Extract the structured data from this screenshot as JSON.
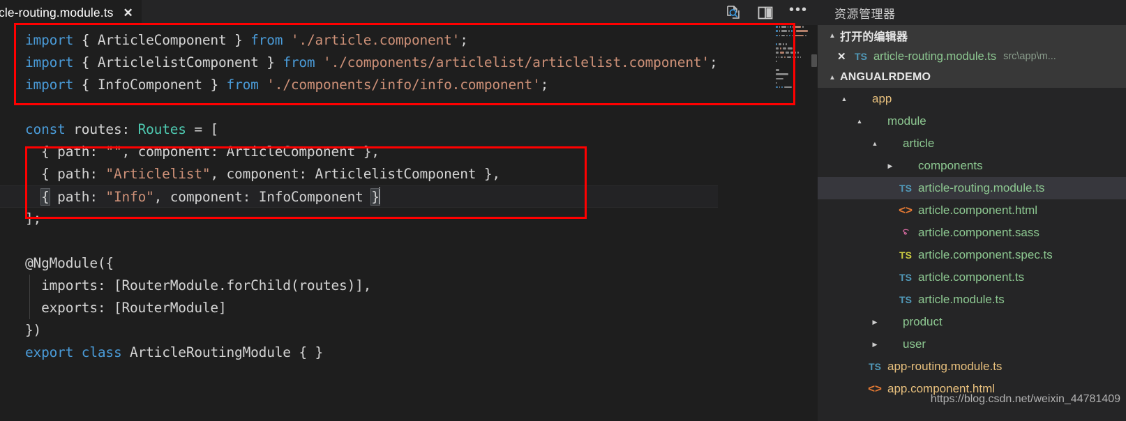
{
  "editor": {
    "tab": {
      "label": "icle-routing.module.ts",
      "close_glyph": "✕"
    },
    "actions": {
      "preview_icon": "open-preview-icon",
      "split_icon": "split-editor-icon",
      "more_glyph": "•••"
    },
    "code_lines": [
      {
        "id": 1,
        "tokens": [
          {
            "t": "import",
            "c": "kw"
          },
          {
            "t": " { ",
            "c": "brk"
          },
          {
            "t": "ArticleComponent",
            "c": "pln"
          },
          {
            "t": " } ",
            "c": "brk"
          },
          {
            "t": "from",
            "c": "kw"
          },
          {
            "t": " ",
            "c": "pln"
          },
          {
            "t": "'./article.component'",
            "c": "str"
          },
          {
            "t": ";",
            "c": "pln"
          }
        ]
      },
      {
        "id": 2,
        "tokens": [
          {
            "t": "import",
            "c": "kw"
          },
          {
            "t": " { ",
            "c": "brk"
          },
          {
            "t": "ArticlelistComponent",
            "c": "pln"
          },
          {
            "t": " } ",
            "c": "brk"
          },
          {
            "t": "from",
            "c": "kw"
          },
          {
            "t": " ",
            "c": "pln"
          },
          {
            "t": "'./components/articlelist/articlelist.component'",
            "c": "str"
          },
          {
            "t": ";",
            "c": "pln"
          }
        ]
      },
      {
        "id": 3,
        "tokens": [
          {
            "t": "import",
            "c": "kw"
          },
          {
            "t": " { ",
            "c": "brk"
          },
          {
            "t": "InfoComponent",
            "c": "pln"
          },
          {
            "t": " } ",
            "c": "brk"
          },
          {
            "t": "from",
            "c": "kw"
          },
          {
            "t": " ",
            "c": "pln"
          },
          {
            "t": "'./components/info/info.component'",
            "c": "str"
          },
          {
            "t": ";",
            "c": "pln"
          }
        ]
      },
      {
        "id": 4,
        "tokens": []
      },
      {
        "id": 5,
        "tokens": [
          {
            "t": "const",
            "c": "kw"
          },
          {
            "t": " routes: ",
            "c": "pln"
          },
          {
            "t": "Routes",
            "c": "typ"
          },
          {
            "t": " = [",
            "c": "pln"
          }
        ]
      },
      {
        "id": 6,
        "tokens": [
          {
            "t": "  { path: ",
            "c": "pln"
          },
          {
            "t": "\"\"",
            "c": "str"
          },
          {
            "t": ", component: ",
            "c": "pln"
          },
          {
            "t": "ArticleComponent",
            "c": "pln"
          },
          {
            "t": " },",
            "c": "pln"
          }
        ]
      },
      {
        "id": 7,
        "tokens": [
          {
            "t": "  { path: ",
            "c": "pln"
          },
          {
            "t": "\"Articlelist\"",
            "c": "str"
          },
          {
            "t": ", component: ",
            "c": "pln"
          },
          {
            "t": "ArticlelistComponent",
            "c": "pln"
          },
          {
            "t": " },",
            "c": "pln"
          }
        ]
      },
      {
        "id": 8,
        "active": true,
        "tokens": [
          {
            "t": "  ",
            "c": "pln"
          },
          {
            "t": "{",
            "c": "match"
          },
          {
            "t": " path: ",
            "c": "pln"
          },
          {
            "t": "\"Info\"",
            "c": "str"
          },
          {
            "t": ", component: ",
            "c": "pln"
          },
          {
            "t": "InfoComponent",
            "c": "pln"
          },
          {
            "t": " ",
            "c": "pln"
          },
          {
            "t": "}",
            "c": "match"
          },
          {
            "t": "__CURSOR__",
            "c": "cursor"
          }
        ]
      },
      {
        "id": 9,
        "tokens": [
          {
            "t": "];",
            "c": "pln"
          }
        ]
      },
      {
        "id": 10,
        "tokens": []
      },
      {
        "id": 11,
        "tokens": [
          {
            "t": "@NgModule({",
            "c": "deco"
          }
        ]
      },
      {
        "id": 12,
        "tokens": [
          {
            "t": "  imports: [RouterModule.forChild(routes)],",
            "c": "pln"
          }
        ]
      },
      {
        "id": 13,
        "tokens": [
          {
            "t": "  exports: [RouterModule]",
            "c": "pln"
          }
        ]
      },
      {
        "id": 14,
        "tokens": [
          {
            "t": "})",
            "c": "pln"
          }
        ]
      },
      {
        "id": 15,
        "tokens": [
          {
            "t": "export",
            "c": "kw"
          },
          {
            "t": " ",
            "c": "pln"
          },
          {
            "t": "class",
            "c": "kw"
          },
          {
            "t": " ArticleRoutingModule { }",
            "c": "pln"
          }
        ]
      }
    ]
  },
  "sidebar": {
    "title": "资源管理器",
    "open_editors": {
      "label": "打开的编辑器",
      "twisty": "▲",
      "items": [
        {
          "close_glyph": "✕",
          "icon": "ts-file-icon",
          "icon_text": "TS",
          "name": "article-routing.module.ts",
          "meta": "src\\app\\m..."
        }
      ]
    },
    "project": {
      "label": "ANGUALRDEMO",
      "twisty": "▲"
    },
    "tree": [
      {
        "depth": 1,
        "arrow": "▲",
        "icon": "none",
        "name": "app",
        "color": "c-tan",
        "type": "folder"
      },
      {
        "depth": 2,
        "arrow": "▲",
        "icon": "none",
        "name": "module",
        "color": "c-green",
        "type": "folder"
      },
      {
        "depth": 3,
        "arrow": "▲",
        "icon": "none",
        "name": "article",
        "color": "c-green",
        "type": "folder"
      },
      {
        "depth": 4,
        "arrow": "▶",
        "icon": "none",
        "name": "components",
        "color": "c-green",
        "type": "folder"
      },
      {
        "depth": 4,
        "arrow": "",
        "icon": "ts",
        "icon_text": "TS",
        "name": "article-routing.module.ts",
        "color": "c-green",
        "type": "file",
        "selected": true
      },
      {
        "depth": 4,
        "arrow": "",
        "icon": "html",
        "icon_text": "<>",
        "name": "article.component.html",
        "color": "c-green",
        "type": "file"
      },
      {
        "depth": 4,
        "arrow": "",
        "icon": "sass",
        "icon_text": "S",
        "name": "article.component.sass",
        "color": "c-green",
        "type": "file"
      },
      {
        "depth": 4,
        "arrow": "",
        "icon": "ts-yellow",
        "icon_text": "TS",
        "name": "article.component.spec.ts",
        "color": "c-green",
        "type": "file"
      },
      {
        "depth": 4,
        "arrow": "",
        "icon": "ts",
        "icon_text": "TS",
        "name": "article.component.ts",
        "color": "c-green",
        "type": "file"
      },
      {
        "depth": 4,
        "arrow": "",
        "icon": "ts",
        "icon_text": "TS",
        "name": "article.module.ts",
        "color": "c-green",
        "type": "file"
      },
      {
        "depth": 3,
        "arrow": "▶",
        "icon": "none",
        "name": "product",
        "color": "c-green",
        "type": "folder"
      },
      {
        "depth": 3,
        "arrow": "▶",
        "icon": "none",
        "name": "user",
        "color": "c-green",
        "type": "folder"
      },
      {
        "depth": 2,
        "arrow": "",
        "icon": "ts",
        "icon_text": "TS",
        "name": "app-routing.module.ts",
        "color": "c-tan",
        "type": "file"
      },
      {
        "depth": 2,
        "arrow": "",
        "icon": "html",
        "icon_text": "<>",
        "name": "app.component.html",
        "color": "c-tan",
        "type": "file"
      }
    ]
  },
  "watermark": "https://blog.csdn.net/weixin_44781409",
  "colors": {
    "annotation_red": "#ff0000",
    "editor_bg": "#1e1e1e",
    "sidebar_bg": "#252526",
    "selected_row": "#37373d",
    "keyword_blue": "#4a9bd8",
    "string_orange": "#ce9178",
    "folder_green": "#8dc891",
    "ts_blue": "#519aba"
  }
}
